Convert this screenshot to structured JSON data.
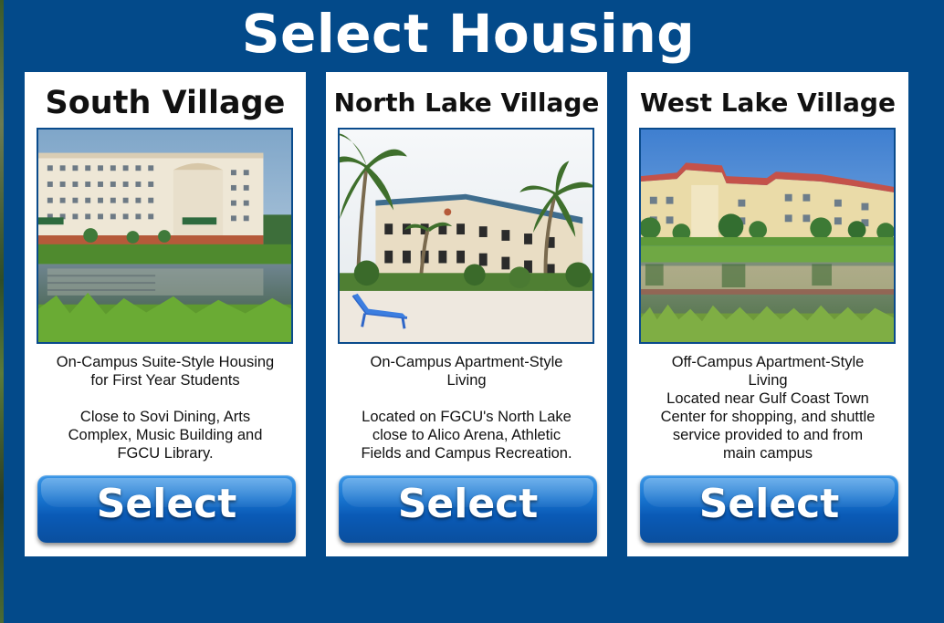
{
  "page": {
    "title": "Select Housing"
  },
  "colors": {
    "background": "#034a8a",
    "card": "#ffffff",
    "button": "#1874cf",
    "photo_border": "#0a4b8c"
  },
  "cards": [
    {
      "title": "South Village",
      "description": "On-Campus Suite-Style Housing\nfor First Year Students\n\nClose to Sovi Dining, Arts\nComplex, Music Building and\nFGCU Library.",
      "photo": "south-village-photo",
      "select_label": "Select"
    },
    {
      "title": "North Lake Village",
      "description": "On-Campus Apartment-Style\nLiving\n\nLocated on FGCU's North Lake\nclose to Alico Arena, Athletic\nFields and Campus Recreation.",
      "photo": "north-lake-village-photo",
      "select_label": "Select"
    },
    {
      "title": "West Lake Village",
      "description": "Off-Campus Apartment-Style\nLiving\nLocated near Gulf Coast Town\nCenter for shopping, and shuttle\nservice provided to and from\nmain campus",
      "photo": "west-lake-village-photo",
      "select_label": "Select"
    }
  ]
}
